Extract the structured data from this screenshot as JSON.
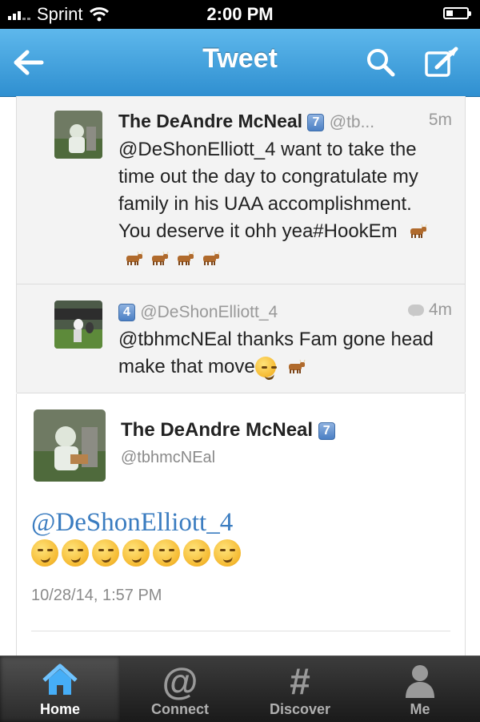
{
  "status_bar": {
    "carrier": "Sprint",
    "time": "2:00 PM",
    "battery_level": 0.35
  },
  "nav": {
    "title": "Tweet",
    "back_icon": "back-arrow-icon",
    "search_icon": "search-icon",
    "compose_icon": "compose-icon"
  },
  "conversation": [
    {
      "name": "The DeAndre McNeal",
      "badge": "7",
      "handle": "@tb...",
      "ago": "5m",
      "text": "@DeShonElliott_4 want to take the time out the day to congratulate my family in his UAA accomplishment. You deserve it ohh yea#HookEm",
      "cow_emoji_count": 5
    },
    {
      "badge": "4",
      "handle": "@DeShonElliott_4",
      "ago": "4m",
      "text": "@tbhmcNEal thanks Fam gone head make that move",
      "smirk_emoji_count": 1,
      "cow_emoji_count": 1
    }
  ],
  "main_tweet": {
    "name": "The DeAndre McNeal",
    "badge": "7",
    "handle": "@tbhmcNEal",
    "mention": "@DeShonElliott_4",
    "smirk_emoji_count": 7,
    "timestamp": "10/28/14, 1:57 PM"
  },
  "tabs": [
    {
      "label": "Home",
      "icon": "home-icon",
      "active": true
    },
    {
      "label": "Connect",
      "icon": "at-sign-icon",
      "active": false
    },
    {
      "label": "Discover",
      "icon": "hashtag-icon",
      "active": false
    },
    {
      "label": "Me",
      "icon": "profile-icon",
      "active": false
    }
  ],
  "colors": {
    "nav_blue": "#3a9be0",
    "link_blue": "#3a7cc0",
    "tab_bar": "#1f1f1f"
  }
}
